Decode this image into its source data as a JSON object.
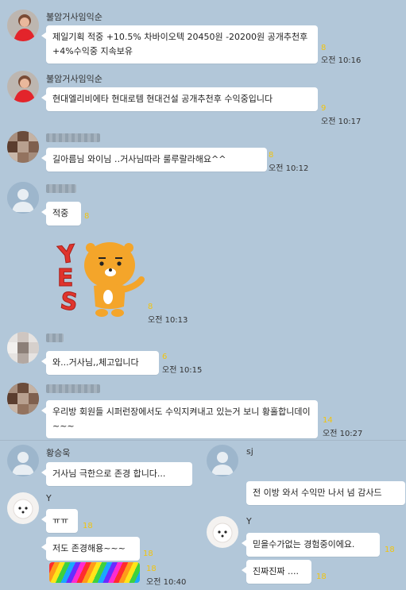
{
  "messages": {
    "m1": {
      "sender": "불암거사임익순",
      "text": "제일기획 적중 +10.5%  차바이오텍 20450원 -20200원 공개추천후 +4%수익중 지속보유",
      "count": "8",
      "time": "오전 10:16"
    },
    "m2": {
      "sender": "불암거사임익순",
      "text": "현대엘리비에타 현대로템 현대건설 공개추천후 수익중입니다",
      "count": "9",
      "time": "오전 10:17"
    },
    "m3": {
      "text": "길아름님 와이님 ‥거사님따라 룰루랄라해요^^",
      "count": "8",
      "time": "오전 10:12"
    },
    "m4": {
      "text": "적중",
      "count": "8"
    },
    "m5": {
      "sticker_text": "YES",
      "count": "8",
      "time": "오전 10:13"
    },
    "m6": {
      "text": "와...거사님,,체고입니다",
      "count": "6",
      "time": "오전 10:15"
    },
    "m7": {
      "text": "우리방 회원들 시퍼런장에서도 수익지켜내고 있는거 보니 황홀합니데이~~~",
      "count": "14",
      "time": "오전 10:27"
    },
    "m8": {
      "sender": "황승욱",
      "text": "거사님 극한으로  존경 합니다..."
    },
    "m9": {
      "sender": "sj",
      "text": "전 이방 와서 수익만 나서 넘 감사드"
    },
    "m10": {
      "sender": "Y",
      "text": "ㅠㅠ",
      "count": "18"
    },
    "m11": {
      "text": "저도 존경해용~~~",
      "count": "18"
    },
    "m12": {
      "count": "18",
      "time": "오전 10:40"
    },
    "m13": {
      "sender": "Y",
      "text": "믿을수가없는 경험중이에요.",
      "count": "18"
    },
    "m14": {
      "text": "진짜진짜 ....",
      "count": "18"
    }
  },
  "colors": {
    "background": "#b2c7d9",
    "bubble": "#ffffff",
    "unread": "#f1c40f"
  }
}
